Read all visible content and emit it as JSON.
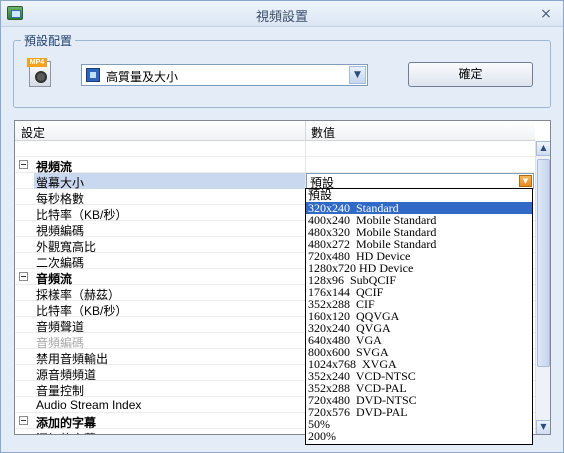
{
  "window": {
    "title": "視頻設置",
    "close_glyph": "×"
  },
  "preset": {
    "group_label": "預設配置",
    "icon_tag": "MP4",
    "selected_value": "高質量及大小",
    "confirm_label": "確定"
  },
  "grid": {
    "headers": {
      "setting": "設定",
      "value": "數值"
    },
    "rows": [
      {
        "type": "blank"
      },
      {
        "type": "cat",
        "name": "視頻流"
      },
      {
        "type": "prop",
        "name": "螢幕大小",
        "value": "預設",
        "selected": true
      },
      {
        "type": "prop",
        "name": "每秒格數"
      },
      {
        "type": "prop",
        "name": "比特率（KB/秒）"
      },
      {
        "type": "prop",
        "name": "視頻編碼"
      },
      {
        "type": "prop",
        "name": "外觀寬高比"
      },
      {
        "type": "prop",
        "name": "二次編碼"
      },
      {
        "type": "cat",
        "name": "音頻流"
      },
      {
        "type": "prop",
        "name": "採樣率（赫茲）"
      },
      {
        "type": "prop",
        "name": "比特率（KB/秒）"
      },
      {
        "type": "prop",
        "name": "音頻聲道"
      },
      {
        "type": "prop",
        "name": "音頻編碼",
        "disabled": true
      },
      {
        "type": "prop",
        "name": "禁用音頻輸出"
      },
      {
        "type": "prop",
        "name": "源音頻頻道"
      },
      {
        "type": "prop",
        "name": "音量控制"
      },
      {
        "type": "prop",
        "name": "Audio Stream Index"
      },
      {
        "type": "cat",
        "name": "添加的字幕"
      },
      {
        "type": "prop",
        "name": "添加的字幕"
      }
    ]
  },
  "screen_size_options": [
    "預設",
    "320x240  Standard",
    "400x240  Mobile Standard",
    "480x320  Mobile Standard",
    "480x272  Mobile Standard",
    "720x480  HD Device",
    "1280x720 HD Device",
    "128x96  SubQCIF",
    "176x144  QCIF",
    "352x288  CIF",
    "160x120  QQVGA",
    "320x240  QVGA",
    "640x480  VGA",
    "800x600  SVGA",
    "1024x768  XVGA",
    "352x240  VCD-NTSC",
    "352x288  VCD-PAL",
    "720x480  DVD-NTSC",
    "720x576  DVD-PAL",
    "50%",
    "200%"
  ],
  "screen_size_highlighted": 1,
  "icons": {
    "app": "app-video-icon",
    "close": "close-icon",
    "mp4": "mp4-file-icon",
    "film": "film-icon",
    "dropdown": "chevron-down-icon",
    "collapse": "collapse-icon",
    "scroll_up": "scroll-up-icon",
    "scroll_down": "scroll-down-icon"
  },
  "colors": {
    "window_bg": "#e3ecf7",
    "selection": "#3169c6",
    "selected_row": "#c9d7ef",
    "accent_orange": "#e88a1a"
  }
}
